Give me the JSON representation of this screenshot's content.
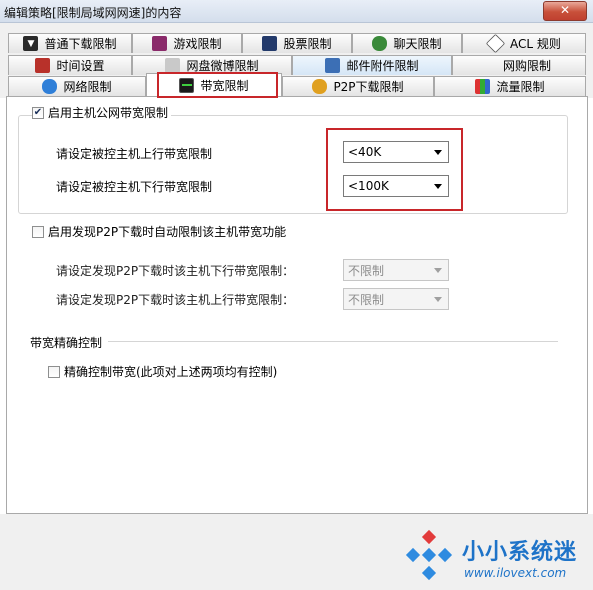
{
  "window": {
    "title": "编辑策略[限制局域网网速]的内容",
    "close": "✕"
  },
  "tabs": {
    "row1": [
      {
        "label": "普通下载限制",
        "icon": "download-icon"
      },
      {
        "label": "游戏限制",
        "icon": "game-icon"
      },
      {
        "label": "股票限制",
        "icon": "stock-icon"
      },
      {
        "label": "聊天限制",
        "icon": "chat-icon"
      },
      {
        "label": "ACL 规则",
        "icon": "acl-icon"
      }
    ],
    "row2": [
      {
        "label": "时间设置",
        "icon": "clock-icon"
      },
      {
        "label": "网盘微博限制",
        "icon": "cloud-icon"
      },
      {
        "label": "邮件附件限制",
        "icon": "mail-icon"
      },
      {
        "label": "网购限制",
        "icon": ""
      }
    ],
    "row3": [
      {
        "label": "网络限制",
        "icon": "ie-icon"
      },
      {
        "label": "带宽限制",
        "icon": "bandwidth-icon"
      },
      {
        "label": "P2P下载限制",
        "icon": "p2p-icon"
      },
      {
        "label": "流量限制",
        "icon": "traffic-icon"
      }
    ]
  },
  "host_bandwidth": {
    "checkbox_label": "启用主机公网带宽限制",
    "checked": true,
    "upload_label": "请设定被控主机上行带宽限制",
    "upload_value": "<40K",
    "download_label": "请设定被控主机下行带宽限制",
    "download_value": "<100K"
  },
  "p2p_auto": {
    "checkbox_label": "启用发现P2P下载时自动限制该主机带宽功能",
    "checked": false,
    "download_label": "请设定发现P2P下载时该主机下行带宽限制：",
    "download_value": "不限制",
    "upload_label": "请设定发现P2P下载时该主机上行带宽限制：",
    "upload_value": "不限制"
  },
  "precise": {
    "section_title": "带宽精确控制",
    "checkbox_label": "精确控制带宽(此项对上述两项均有控制)",
    "checked": false
  },
  "watermark": {
    "text": "小小系统迷",
    "url": "www.ilovext.com"
  },
  "colors": {
    "highlight": "#c8262a",
    "watermark": "#1e73c8"
  }
}
